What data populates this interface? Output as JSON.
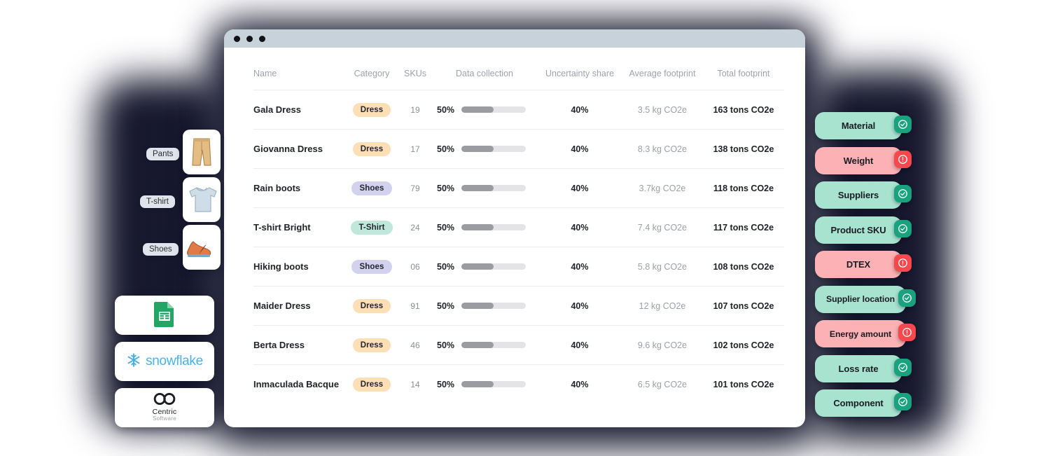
{
  "window": {
    "traffic_lights": 3,
    "chrome_color": "#c7d2db"
  },
  "table": {
    "columns": [
      {
        "key": "name",
        "label": "Name"
      },
      {
        "key": "category",
        "label": "Category"
      },
      {
        "key": "skus",
        "label": "SKUs"
      },
      {
        "key": "data_collection",
        "label": "Data collection"
      },
      {
        "key": "uncertainty",
        "label": "Uncertainty share"
      },
      {
        "key": "average_footprint",
        "label": "Average footprint"
      },
      {
        "key": "total_footprint",
        "label": "Total footprint"
      }
    ],
    "rows": [
      {
        "name": "Gala Dress",
        "category": "Dress",
        "category_style": "dress",
        "skus": "19",
        "data_collection": "50%",
        "data_collection_value": 50,
        "uncertainty": "40%",
        "average_footprint": "3.5 kg CO2e",
        "total_footprint": "163 tons CO2e"
      },
      {
        "name": "Giovanna Dress",
        "category": "Dress",
        "category_style": "dress",
        "skus": "17",
        "data_collection": "50%",
        "data_collection_value": 50,
        "uncertainty": "40%",
        "average_footprint": "8.3 kg CO2e",
        "total_footprint": "138 tons CO2e"
      },
      {
        "name": "Rain boots",
        "category": "Shoes",
        "category_style": "shoes",
        "skus": "79",
        "data_collection": "50%",
        "data_collection_value": 50,
        "uncertainty": "40%",
        "average_footprint": "3.7kg CO2e",
        "total_footprint": "118 tons CO2e"
      },
      {
        "name": "T-shirt Bright",
        "category": "T-Shirt",
        "category_style": "tshirt",
        "skus": "24",
        "data_collection": "50%",
        "data_collection_value": 50,
        "uncertainty": "40%",
        "average_footprint": "7.4 kg CO2e",
        "total_footprint": "117 tons CO2e"
      },
      {
        "name": "Hiking boots",
        "category": "Shoes",
        "category_style": "shoes",
        "skus": "06",
        "data_collection": "50%",
        "data_collection_value": 50,
        "uncertainty": "40%",
        "average_footprint": "5.8 kg CO2e",
        "total_footprint": "108 tons CO2e"
      },
      {
        "name": "Maider Dress",
        "category": "Dress",
        "category_style": "dress",
        "skus": "91",
        "data_collection": "50%",
        "data_collection_value": 50,
        "uncertainty": "40%",
        "average_footprint": "12 kg CO2e",
        "total_footprint": "107 tons CO2e"
      },
      {
        "name": "Berta Dress",
        "category": "Dress",
        "category_style": "dress",
        "skus": "46",
        "data_collection": "50%",
        "data_collection_value": 50,
        "uncertainty": "40%",
        "average_footprint": "9.6 kg CO2e",
        "total_footprint": "102 tons CO2e"
      },
      {
        "name": "Inmaculada Bacque",
        "category": "Dress",
        "category_style": "dress",
        "skus": "14",
        "data_collection": "50%",
        "data_collection_value": 50,
        "uncertainty": "40%",
        "average_footprint": "6.5 kg CO2e",
        "total_footprint": "101 tons CO2e"
      }
    ]
  },
  "left_rail": {
    "products": [
      {
        "label": "Pants",
        "icon": "pants-image"
      },
      {
        "label": "T-shirt",
        "icon": "tshirt-image"
      },
      {
        "label": "Shoes",
        "icon": "shoes-image"
      }
    ],
    "integrations": [
      {
        "name": "google-sheets",
        "label": ""
      },
      {
        "name": "snowflake",
        "label": "snowflake"
      },
      {
        "name": "centric-software",
        "label": "Centric",
        "sublabel": "Software"
      }
    ]
  },
  "right_rail": {
    "badges": [
      {
        "label": "Material",
        "status": "ok",
        "icon": "check-circle-icon"
      },
      {
        "label": "Weight",
        "status": "err",
        "icon": "alert-circle-icon"
      },
      {
        "label": "Suppliers",
        "status": "ok",
        "icon": "check-circle-icon"
      },
      {
        "label": "Product SKU",
        "status": "ok",
        "icon": "check-circle-icon"
      },
      {
        "label": "DTEX",
        "status": "err",
        "icon": "alert-circle-icon"
      },
      {
        "label": "Supplier location",
        "status": "ok",
        "icon": "check-circle-icon",
        "wide": true
      },
      {
        "label": "Energy amount",
        "status": "err",
        "icon": "alert-circle-icon",
        "wide": true
      },
      {
        "label": "Loss rate",
        "status": "ok",
        "icon": "check-circle-icon"
      },
      {
        "label": "Component",
        "status": "ok",
        "icon": "check-circle-icon"
      }
    ]
  },
  "colors": {
    "ok_badge": "#a8e3d0",
    "err_badge": "#fcb2b4",
    "ok_mark": "#18a37e",
    "err_mark": "#f8484e",
    "pill_dress": "#fcdfb4",
    "pill_shoes": "#d2d1ee",
    "pill_tshirt": "#bfe8db",
    "bar_fill": "#9a9ca1",
    "bar_track": "#e4e4e6",
    "backdrop": "#15162b"
  }
}
